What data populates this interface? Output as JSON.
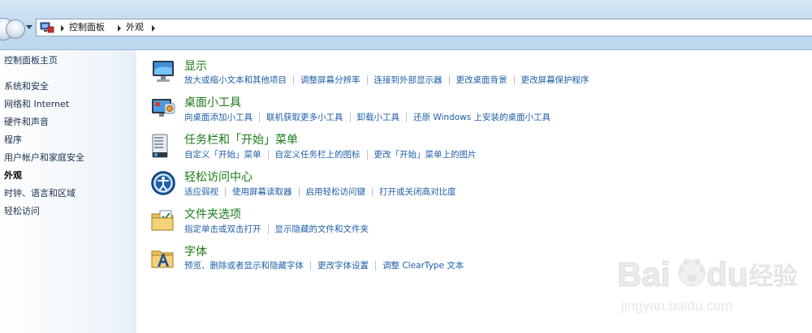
{
  "breadcrumb": [
    "控制面板",
    "外观"
  ],
  "left_nav": {
    "home": "控制面板主页",
    "items": [
      {
        "label": "系统和安全",
        "current": false
      },
      {
        "label": "网络和 Internet",
        "current": false
      },
      {
        "label": "硬件和声音",
        "current": false
      },
      {
        "label": "程序",
        "current": false
      },
      {
        "label": "用户帐户和家庭安全",
        "current": false
      },
      {
        "label": "外观",
        "current": true
      },
      {
        "label": "时钟、语言和区域",
        "current": false
      },
      {
        "label": "轻松访问",
        "current": false
      }
    ]
  },
  "categories": [
    {
      "title": "显示",
      "icon": "monitor-icon",
      "tasks": [
        "放大或缩小文本和其他项目",
        "调整屏幕分辨率",
        "连接到外部显示器",
        "更改桌面背景",
        "更改屏幕保护程序"
      ]
    },
    {
      "title": "桌面小工具",
      "icon": "gadgets-icon",
      "tasks": [
        "向桌面添加小工具",
        "联机获取更多小工具",
        "卸载小工具",
        "还原 Windows 上安装的桌面小工具"
      ]
    },
    {
      "title": "任务栏和「开始」菜单",
      "icon": "taskbar-icon",
      "tasks": [
        "自定义「开始」菜单",
        "自定义任务栏上的图标",
        "更改「开始」菜单上的图片"
      ]
    },
    {
      "title": "轻松访问中心",
      "icon": "ease-of-access-icon",
      "tasks": [
        "适应弱视",
        "使用屏幕读取器",
        "启用轻松访问键",
        "打开或关闭高对比度"
      ]
    },
    {
      "title": "文件夹选项",
      "icon": "folder-options-icon",
      "tasks": [
        "指定单击或双击打开",
        "显示隐藏的文件和文件夹"
      ]
    },
    {
      "title": "字体",
      "icon": "fonts-icon",
      "tasks": [
        "预览、删除或者显示和隐藏字体",
        "更改字体设置",
        "调整 ClearType 文本"
      ]
    }
  ],
  "watermark": {
    "brand": "Bai",
    "brand2": "du",
    "cn": "经验",
    "url": "jingyan.baidu.com"
  },
  "colors": {
    "category_title": "#1b7a17",
    "task_link": "#1f5ea8",
    "nav_text": "#1a2f4d"
  }
}
